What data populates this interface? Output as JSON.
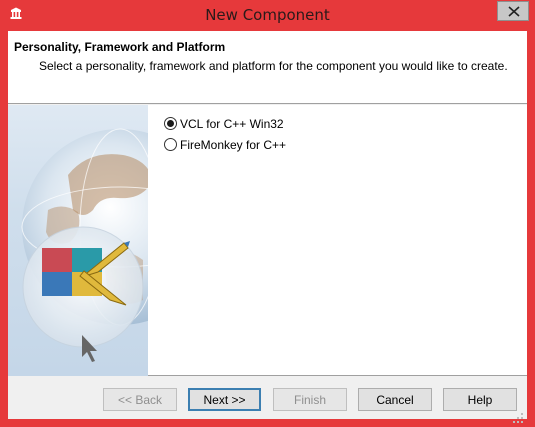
{
  "window": {
    "title": "New Component"
  },
  "header": {
    "title": "Personality, Framework and Platform",
    "description": "Select a personality, framework and platform for the component you would like to create."
  },
  "options": [
    {
      "label": "VCL for C++ Win32",
      "checked": true
    },
    {
      "label": "FireMonkey for C++",
      "checked": false
    }
  ],
  "buttons": {
    "back": "<< Back",
    "next": "Next >>",
    "finish": "Finish",
    "cancel": "Cancel",
    "help": "Help"
  },
  "colors": {
    "frame": "#e6393b",
    "client": "#f0f0f0",
    "default_button_border": "#3c7fb1"
  },
  "icons": {
    "app": "app-icon",
    "close": "close-icon",
    "wizard_art": "globe-component-illustration",
    "grip": "resize-grip-icon"
  }
}
